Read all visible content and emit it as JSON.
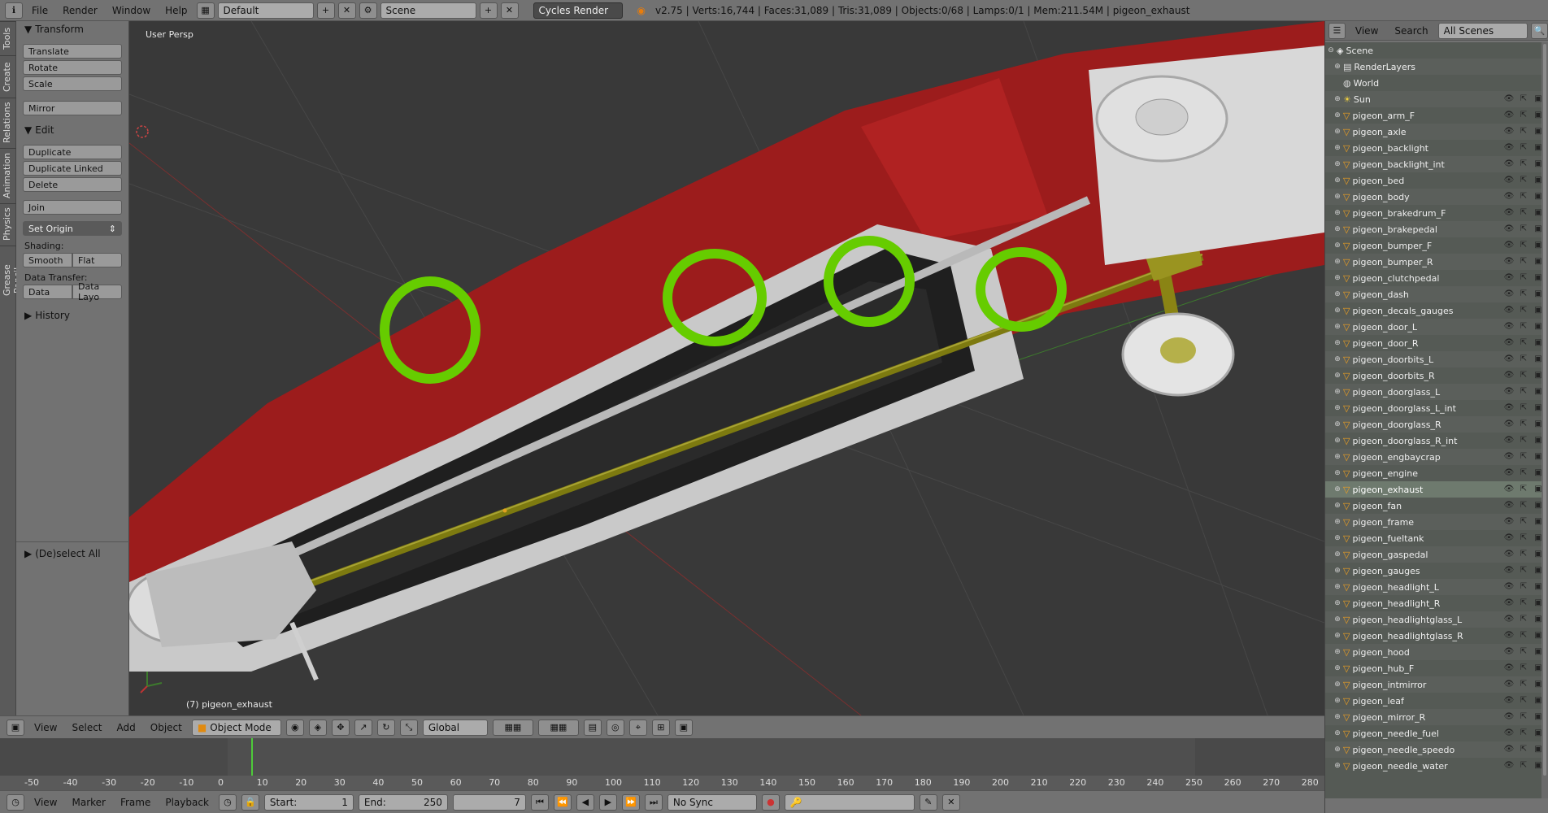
{
  "topbar": {
    "menus": [
      "File",
      "Render",
      "Window",
      "Help"
    ],
    "layout": "Default",
    "scene": "Scene",
    "engine": "Cycles Render",
    "stats": "v2.75 | Verts:16,744 | Faces:31,089 | Tris:31,089 | Objects:0/68 | Lamps:0/1 | Mem:211.54M | pigeon_exhaust"
  },
  "left_tabs": [
    "Tools",
    "Create",
    "Relations",
    "Animation",
    "Physics",
    "Grease Pencil"
  ],
  "tools": {
    "transform_title": "Transform",
    "translate": "Translate",
    "rotate": "Rotate",
    "scale": "Scale",
    "mirror": "Mirror",
    "edit_title": "Edit",
    "duplicate": "Duplicate",
    "duplicate_linked": "Duplicate Linked",
    "delete": "Delete",
    "join": "Join",
    "set_origin": "Set Origin",
    "shading_label": "Shading:",
    "smooth": "Smooth",
    "flat": "Flat",
    "data_transfer_label": "Data Transfer:",
    "data": "Data",
    "data_layo": "Data Layo",
    "history": "History",
    "deselect_all": "(De)select All"
  },
  "viewport": {
    "view_name": "User Persp",
    "object_label": "(7) pigeon_exhaust",
    "highlight_color": "#66cc00"
  },
  "view3d_header": {
    "menus": [
      "View",
      "Select",
      "Add",
      "Object"
    ],
    "mode": "Object Mode",
    "orientation": "Global"
  },
  "timeline": {
    "ticks": [
      "-50",
      "-40",
      "-30",
      "-20",
      "-10",
      "0",
      "10",
      "20",
      "30",
      "40",
      "50",
      "60",
      "70",
      "80",
      "90",
      "100",
      "110",
      "120",
      "130",
      "140",
      "150",
      "160",
      "170",
      "180",
      "190",
      "200",
      "210",
      "220",
      "230",
      "240",
      "250",
      "260",
      "270",
      "280"
    ],
    "current_frame_marker": 7
  },
  "bottom_bar": {
    "menus": [
      "View",
      "Marker",
      "Frame",
      "Playback"
    ],
    "start_label": "Start:",
    "start_value": "1",
    "end_label": "End:",
    "end_value": "250",
    "current_frame": "7",
    "sync": "No Sync"
  },
  "outliner": {
    "menus": [
      "View",
      "Search"
    ],
    "filter": "All Scenes",
    "scene_root": "Scene",
    "items": [
      {
        "name": "RenderLayers",
        "kind": "renderlayers"
      },
      {
        "name": "World",
        "kind": "world"
      },
      {
        "name": "Sun",
        "kind": "lamp"
      },
      {
        "name": "pigeon_arm_F",
        "kind": "mesh"
      },
      {
        "name": "pigeon_axle",
        "kind": "mesh"
      },
      {
        "name": "pigeon_backlight",
        "kind": "mesh"
      },
      {
        "name": "pigeon_backlight_int",
        "kind": "mesh"
      },
      {
        "name": "pigeon_bed",
        "kind": "mesh"
      },
      {
        "name": "pigeon_body",
        "kind": "mesh"
      },
      {
        "name": "pigeon_brakedrum_F",
        "kind": "mesh"
      },
      {
        "name": "pigeon_brakepedal",
        "kind": "mesh"
      },
      {
        "name": "pigeon_bumper_F",
        "kind": "mesh"
      },
      {
        "name": "pigeon_bumper_R",
        "kind": "mesh"
      },
      {
        "name": "pigeon_clutchpedal",
        "kind": "mesh"
      },
      {
        "name": "pigeon_dash",
        "kind": "mesh"
      },
      {
        "name": "pigeon_decals_gauges",
        "kind": "mesh"
      },
      {
        "name": "pigeon_door_L",
        "kind": "mesh"
      },
      {
        "name": "pigeon_door_R",
        "kind": "mesh"
      },
      {
        "name": "pigeon_doorbits_L",
        "kind": "mesh"
      },
      {
        "name": "pigeon_doorbits_R",
        "kind": "mesh"
      },
      {
        "name": "pigeon_doorglass_L",
        "kind": "mesh"
      },
      {
        "name": "pigeon_doorglass_L_int",
        "kind": "mesh"
      },
      {
        "name": "pigeon_doorglass_R",
        "kind": "mesh"
      },
      {
        "name": "pigeon_doorglass_R_int",
        "kind": "mesh"
      },
      {
        "name": "pigeon_engbaycrap",
        "kind": "mesh"
      },
      {
        "name": "pigeon_engine",
        "kind": "mesh"
      },
      {
        "name": "pigeon_exhaust",
        "kind": "mesh",
        "active": true
      },
      {
        "name": "pigeon_fan",
        "kind": "mesh"
      },
      {
        "name": "pigeon_frame",
        "kind": "mesh"
      },
      {
        "name": "pigeon_fueltank",
        "kind": "mesh"
      },
      {
        "name": "pigeon_gaspedal",
        "kind": "mesh"
      },
      {
        "name": "pigeon_gauges",
        "kind": "mesh"
      },
      {
        "name": "pigeon_headlight_L",
        "kind": "mesh"
      },
      {
        "name": "pigeon_headlight_R",
        "kind": "mesh"
      },
      {
        "name": "pigeon_headlightglass_L",
        "kind": "mesh"
      },
      {
        "name": "pigeon_headlightglass_R",
        "kind": "mesh"
      },
      {
        "name": "pigeon_hood",
        "kind": "mesh"
      },
      {
        "name": "pigeon_hub_F",
        "kind": "mesh"
      },
      {
        "name": "pigeon_intmirror",
        "kind": "mesh"
      },
      {
        "name": "pigeon_leaf",
        "kind": "mesh"
      },
      {
        "name": "pigeon_mirror_R",
        "kind": "mesh"
      },
      {
        "name": "pigeon_needle_fuel",
        "kind": "mesh"
      },
      {
        "name": "pigeon_needle_speedo",
        "kind": "mesh"
      },
      {
        "name": "pigeon_needle_water",
        "kind": "mesh"
      }
    ]
  }
}
